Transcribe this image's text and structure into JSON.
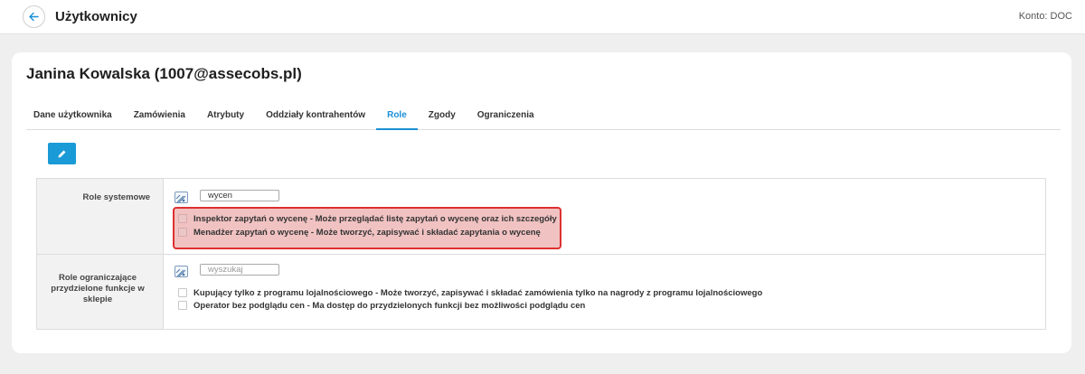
{
  "header": {
    "title": "Użytkownicy",
    "account": "Konto: DOC"
  },
  "user": {
    "name": "Janina Kowalska (1007@assecobs.pl)"
  },
  "tabs": [
    {
      "label": "Dane użytkownika"
    },
    {
      "label": "Zamówienia"
    },
    {
      "label": "Atrybuty"
    },
    {
      "label": "Oddziały kontrahentów"
    },
    {
      "label": "Role"
    },
    {
      "label": "Zgody"
    },
    {
      "label": "Ograniczenia"
    }
  ],
  "active_tab": "Role",
  "colors": {
    "accent": "#1a9ad6",
    "highlight_border": "#de3030"
  },
  "system_roles": {
    "label": "Role systemowe",
    "filter_value": "wycen",
    "filter_placeholder": "",
    "items": [
      {
        "label": "Inspektor zapytań o wycenę - Może przeglądać listę zapytań o wycenę oraz ich szczegóły",
        "checked": false
      },
      {
        "label": "Menadżer zapytań o wycenę - Może tworzyć, zapisywać i składać zapytania o wycenę",
        "checked": false
      }
    ]
  },
  "limiting_roles": {
    "label": "Role ograniczające przydzielone funkcje w sklepie",
    "filter_value": "",
    "filter_placeholder": "wyszukaj",
    "items": [
      {
        "label": "Kupujący tylko z programu lojalnościowego - Może tworzyć, zapisywać i składać zamówienia tylko na nagrody z programu lojalnościowego",
        "checked": false
      },
      {
        "label": "Operator bez podglądu cen - Ma dostęp do przydzielonych funkcji bez możliwości podglądu cen",
        "checked": false
      }
    ]
  }
}
